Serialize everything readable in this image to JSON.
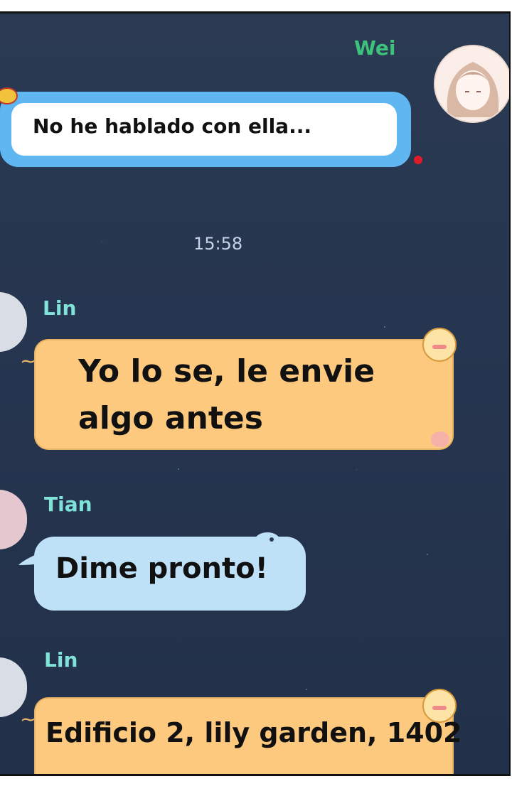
{
  "messages": [
    {
      "sender": "Wei",
      "text": "No he hablado con ella..."
    },
    {
      "sender": "Lin",
      "text_line1": "Yo lo se, le envie",
      "text_line2": "algo antes"
    },
    {
      "sender": "Tian",
      "text": "Dime pronto!"
    },
    {
      "sender": "Lin",
      "text": "Edificio 2, lily garden, 1402"
    }
  ],
  "timestamp": "15:58",
  "colors": {
    "background": "#273650",
    "blue_bubble": "#5fb6f0",
    "orange_bubble": "#fcc97f",
    "light_blue_bubble": "#bfe1f7",
    "name_wei": "#3cc27a",
    "name_other": "#7fe3d8"
  }
}
